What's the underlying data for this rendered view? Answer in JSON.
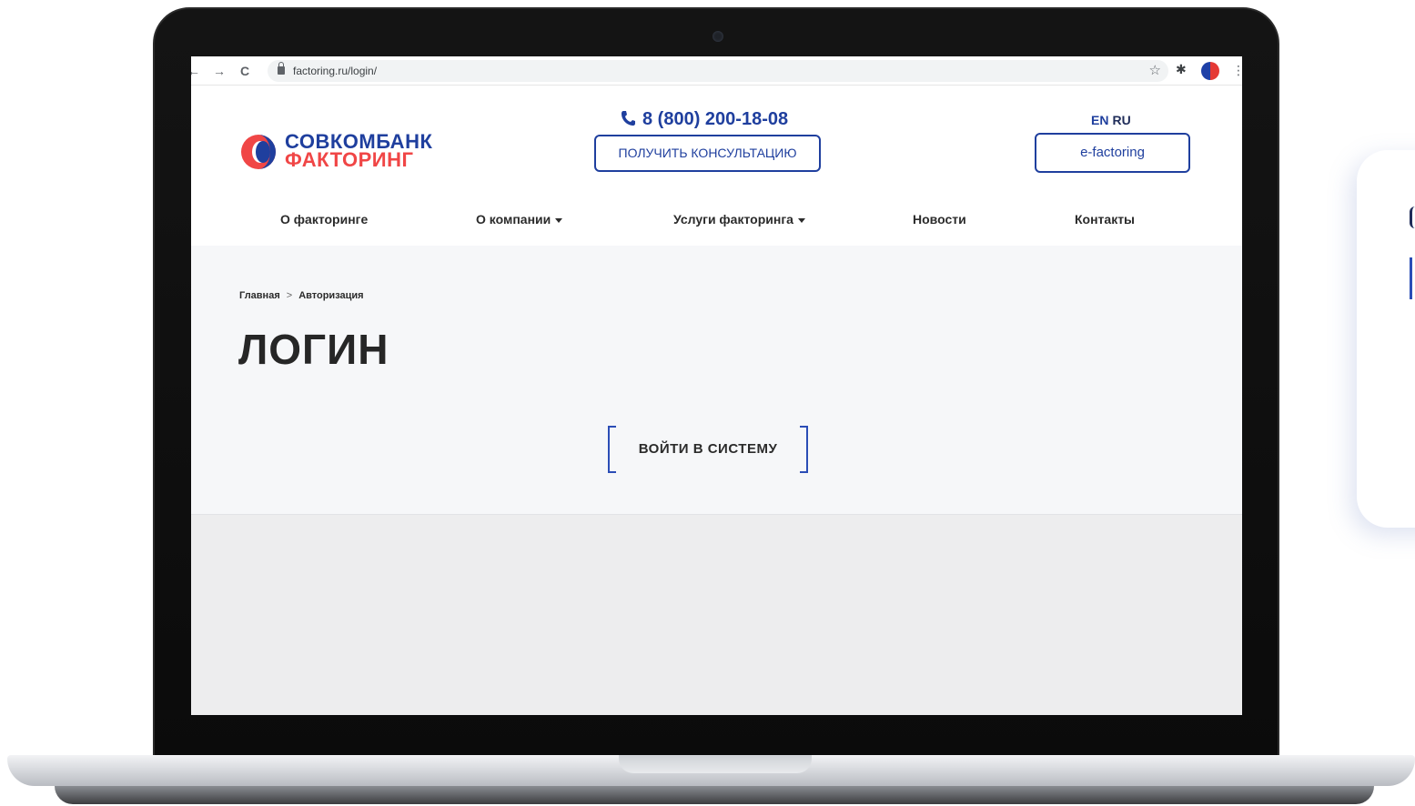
{
  "browser": {
    "back_glyph": "←",
    "forward_glyph": "→",
    "reload_glyph": "C",
    "url": "factoring.ru/login/",
    "star_glyph": "☆",
    "extensions_glyph": "✱",
    "menu_glyph": "⋮"
  },
  "header": {
    "logo_line1": "СОВКОМБАНК",
    "logo_line2": "ФАКТОРИНГ",
    "phone_icon": "📞",
    "phone": "8 (800) 200-18-08",
    "consult_button": "ПОЛУЧИТЬ КОНСУЛЬТАЦИЮ",
    "lang_en": "EN",
    "lang_ru": "RU",
    "efactoring_button": "e-factoring"
  },
  "nav": {
    "items": [
      {
        "label": "О факторинге"
      },
      {
        "label": "О компании"
      },
      {
        "label": "Услуги факторинга"
      },
      {
        "label": "Новости"
      },
      {
        "label": "Контакты"
      }
    ]
  },
  "breadcrumb": {
    "home": "Главная",
    "separator": ">",
    "current": "Авторизация"
  },
  "page": {
    "title": "ЛОГИН",
    "login_button": "ВОЙТИ В СИСТЕМУ"
  },
  "colors": {
    "brand_blue": "#1f3f9e",
    "brand_red": "#f04646",
    "content_bg": "#f6f7f9"
  }
}
